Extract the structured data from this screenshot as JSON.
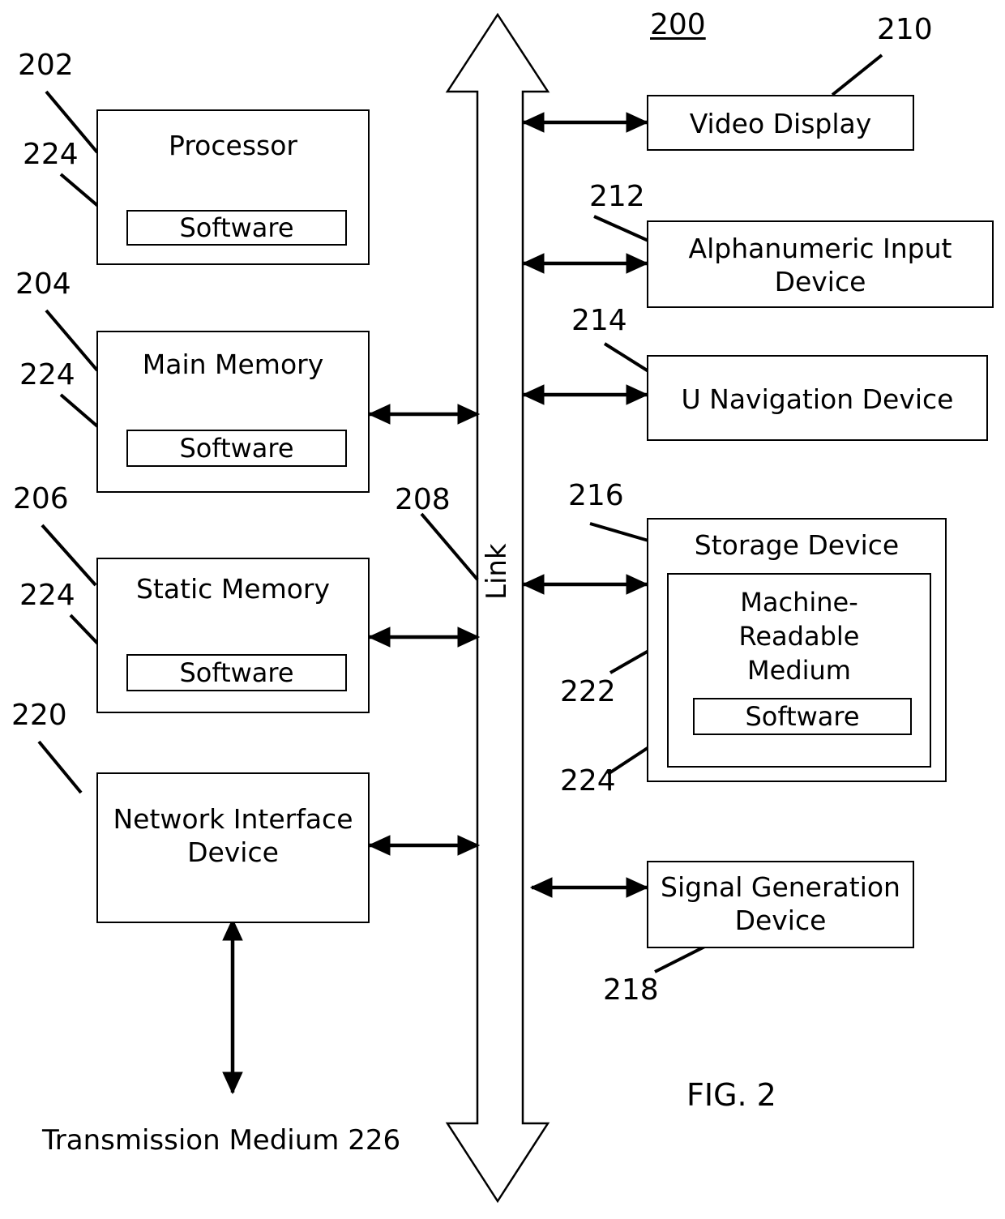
{
  "figure": {
    "id": "FIG. 2",
    "system_ref": "200",
    "caption": "FIG. 2"
  },
  "bus": {
    "label": "Link",
    "ref": "208"
  },
  "left_column": [
    {
      "ref": "202",
      "title": "Processor",
      "inner": {
        "ref": "224",
        "label": "Software"
      }
    },
    {
      "ref": "204",
      "title": "Main Memory",
      "inner": {
        "ref": "224",
        "label": "Software"
      }
    },
    {
      "ref": "206",
      "title": "Static Memory",
      "inner": {
        "ref": "224",
        "label": "Software"
      }
    },
    {
      "ref": "220",
      "title": "Network Interface\nDevice",
      "inner": null
    }
  ],
  "right_column": [
    {
      "ref": "210",
      "title": "Video Display",
      "inner": null
    },
    {
      "ref": "212",
      "title": "Alphanumeric Input\nDevice",
      "inner": null
    },
    {
      "ref": "214",
      "title": "U Navigation Device",
      "inner": null
    },
    {
      "ref": "216",
      "title": "Storage Device",
      "inner": {
        "ref": "222",
        "title": "Machine-\nReadable\nMedium",
        "inner": {
          "ref": "224",
          "label": "Software"
        }
      }
    },
    {
      "ref": "218",
      "title": "Signal Generation\nDevice",
      "inner": null
    }
  ],
  "transmission_medium": {
    "label": "Transmission Medium 226"
  },
  "colors": {
    "stroke": "#000000",
    "fill": "#ffffff",
    "text": "#000000"
  }
}
